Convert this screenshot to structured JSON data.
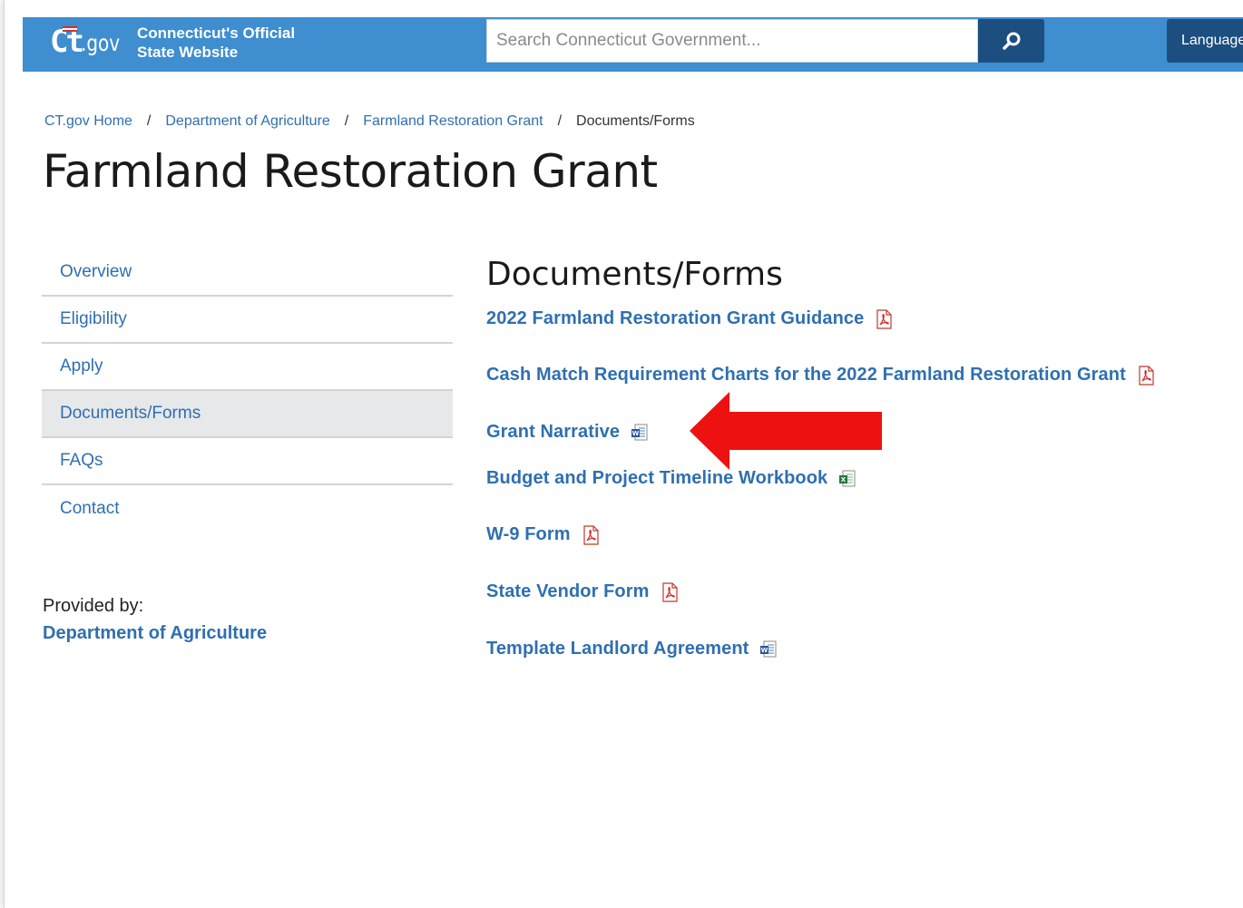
{
  "header": {
    "logo_ct": "Ct",
    "logo_gov": ".gov",
    "logo_line1": "Connecticut's Official",
    "logo_line2": "State Website",
    "search_placeholder": "Search Connecticut Government...",
    "language_label": "Language"
  },
  "breadcrumb": [
    {
      "label": "CT.gov Home"
    },
    {
      "label": "Department of Agriculture"
    },
    {
      "label": "Farmland Restoration Grant"
    },
    {
      "label": "Documents/Forms"
    }
  ],
  "breadcrumb_separator": "/",
  "page_title": "Farmland Restoration Grant",
  "sidebar": {
    "items": [
      {
        "label": "Overview"
      },
      {
        "label": "Eligibility"
      },
      {
        "label": "Apply"
      },
      {
        "label": "Documents/Forms",
        "active": true
      },
      {
        "label": "FAQs"
      },
      {
        "label": "Contact"
      }
    ],
    "provided_by_label": "Provided by:",
    "provided_by_dept": "Department of Agriculture"
  },
  "documents": {
    "heading": "Documents/Forms",
    "links": [
      {
        "label": "2022 Farmland Restoration Grant Guidance",
        "file_icon": "pdf-icon"
      },
      {
        "label": "Cash Match Requirement Charts for the 2022 Farmland Restoration Grant",
        "file_icon": "pdf-icon"
      },
      {
        "label": "Grant Narrative",
        "file_icon": "word-doc-icon"
      },
      {
        "label": "Budget and Project Timeline Workbook",
        "file_icon": "excel-icon"
      },
      {
        "label": "W-9 Form",
        "file_icon": "pdf-icon"
      },
      {
        "label": "State Vendor Form",
        "file_icon": "pdf-icon"
      },
      {
        "label": "Template Landlord Agreement",
        "file_icon": "word-doc-icon"
      }
    ]
  },
  "annotation": {
    "type": "red-arrow",
    "points_to": "Grant Narrative",
    "color": "#ee1111"
  },
  "colors": {
    "header_bg": "#3e8ed0",
    "header_button_bg": "#1c4e80",
    "link": "#2f6fb0",
    "active_nav_bg": "#e6e8ea"
  }
}
